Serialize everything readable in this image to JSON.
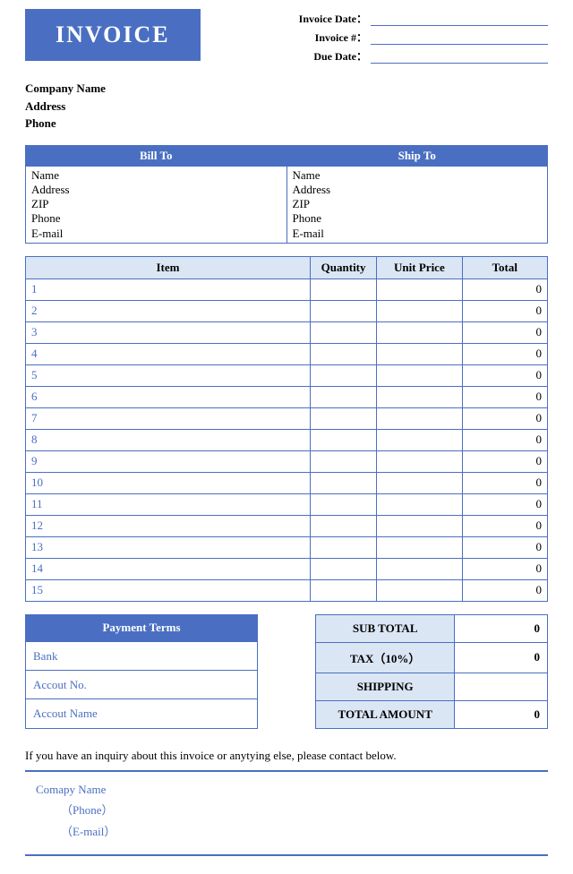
{
  "header": {
    "badge": "INVOICE",
    "meta": {
      "date_label": "Invoice Date：",
      "number_label": "Invoice #：",
      "due_label": "Due Date："
    }
  },
  "company": {
    "name_label": "Company Name",
    "address_label": "Address",
    "phone_label": "Phone"
  },
  "billship": {
    "bill_header": "Bill To",
    "ship_header": "Ship To",
    "fields": {
      "name": "Name",
      "address": "Address",
      "zip": "ZIP",
      "phone": "Phone",
      "email": "E-mail"
    }
  },
  "items": {
    "headers": {
      "item": "Item",
      "qty": "Quantity",
      "price": "Unit Price",
      "total": "Total"
    },
    "rows": [
      {
        "idx": "1",
        "total": "0"
      },
      {
        "idx": "2",
        "total": "0"
      },
      {
        "idx": "3",
        "total": "0"
      },
      {
        "idx": "4",
        "total": "0"
      },
      {
        "idx": "5",
        "total": "0"
      },
      {
        "idx": "6",
        "total": "0"
      },
      {
        "idx": "7",
        "total": "0"
      },
      {
        "idx": "8",
        "total": "0"
      },
      {
        "idx": "9",
        "total": "0"
      },
      {
        "idx": "10",
        "total": "0"
      },
      {
        "idx": "11",
        "total": "0"
      },
      {
        "idx": "12",
        "total": "0"
      },
      {
        "idx": "13",
        "total": "0"
      },
      {
        "idx": "14",
        "total": "0"
      },
      {
        "idx": "15",
        "total": "0"
      }
    ]
  },
  "payment": {
    "header": "Payment Terms",
    "bank": "Bank",
    "account_no": "Accout No.",
    "account_name": "Accout Name"
  },
  "totals": {
    "subtotal_label": "SUB TOTAL",
    "subtotal_value": "0",
    "tax_label": "TAX（10%）",
    "tax_value": "0",
    "shipping_label": "SHIPPING",
    "shipping_value": "",
    "total_label": "TOTAL AMOUNT",
    "total_value": "0"
  },
  "footer": {
    "inquiry": "If you have an inquiry about this invoice or anytying else, please contact below.",
    "company": "Comapy Name",
    "phone": "（Phone）",
    "email": "（E-mail）"
  }
}
